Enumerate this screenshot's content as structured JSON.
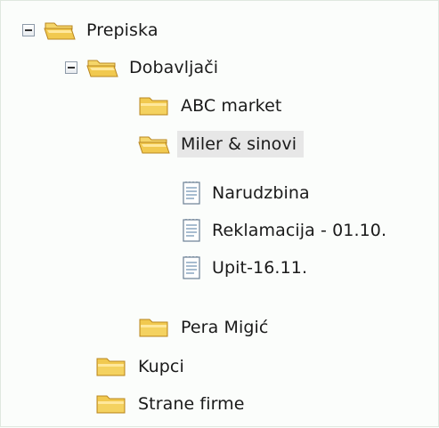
{
  "tree": [
    {
      "label": "Prepiska",
      "icon": "open-folder-icon",
      "expanded": true
    },
    {
      "label": "Dobavljači",
      "icon": "open-folder-icon",
      "expanded": true
    },
    {
      "label": "ABC market",
      "icon": "folder-icon"
    },
    {
      "label": "Miler & sinovi",
      "icon": "open-folder-icon",
      "selected": true
    },
    {
      "label": "Narudzbina",
      "icon": "document-icon"
    },
    {
      "label": "Reklamacija - 01.10.",
      "icon": "document-icon"
    },
    {
      "label": "Upit-16.11.",
      "icon": "document-icon"
    },
    {
      "label": "Pera Migić",
      "icon": "folder-icon"
    },
    {
      "label": "Kupci",
      "icon": "folder-icon"
    },
    {
      "label": "Strane firme",
      "icon": "folder-icon"
    }
  ],
  "colors": {
    "folder_fill": "#f1c94f",
    "folder_shadow": "#d9a52f",
    "selection_bg": "#e7e7e7",
    "document_lines": "#8aa6c1"
  }
}
